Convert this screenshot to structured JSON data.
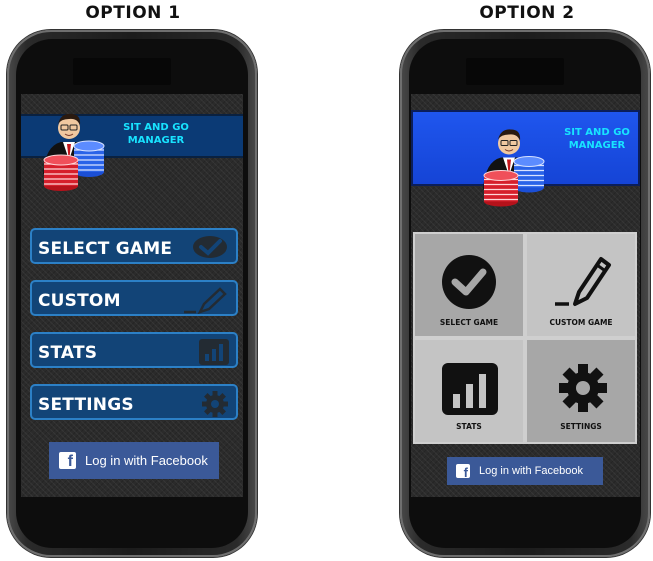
{
  "options": [
    {
      "title": "OPTION 1",
      "banner_line1": "SIT AND GO",
      "banner_line2": "MANAGER",
      "menu": [
        {
          "label": "SELECT GAME",
          "icon": "checkmark-circle-icon"
        },
        {
          "label": "CUSTOM",
          "icon": "pencil-icon"
        },
        {
          "label": "STATS",
          "icon": "bar-chart-icon"
        },
        {
          "label": "SETTINGS",
          "icon": "gear-icon"
        }
      ],
      "facebook": "Log in with Facebook"
    },
    {
      "title": "OPTION 2",
      "banner_line1": "SIT AND GO",
      "banner_line2": "MANAGER",
      "tiles": [
        {
          "label": "SELECT GAME",
          "icon": "checkmark-circle-icon"
        },
        {
          "label": "CUSTOM GAME",
          "icon": "pencil-icon"
        },
        {
          "label": "STATS",
          "icon": "bar-chart-icon"
        },
        {
          "label": "SETTINGS",
          "icon": "gear-icon"
        }
      ],
      "facebook": "Log in with Facebook"
    }
  ],
  "colors": {
    "banner_option1": "#0b3a75",
    "banner_option2": "#1f56ee",
    "banner_text": "#18e3ff",
    "menu_button": "#124477",
    "menu_border": "#2c80c6",
    "facebook": "#3b5998",
    "tile_dark": "#a7a7a7",
    "tile_light": "#c4c4c4"
  }
}
